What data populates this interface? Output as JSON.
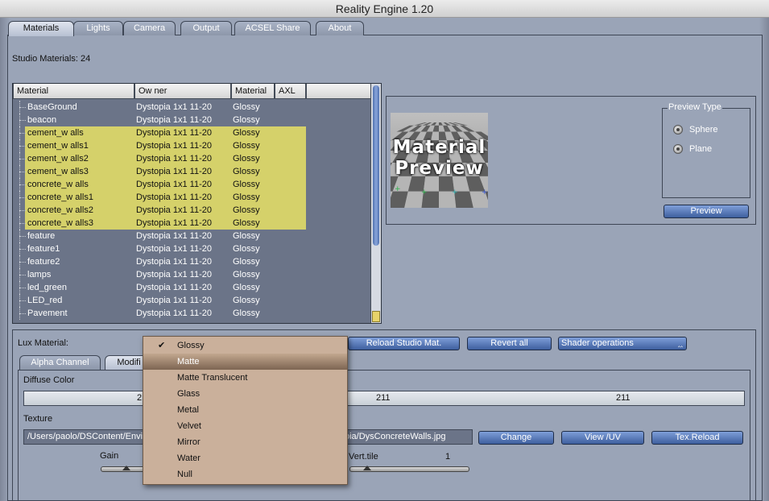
{
  "window": {
    "title": "Reality Engine 1.20"
  },
  "tabs": [
    {
      "label": "Materials",
      "active": true
    },
    {
      "label": "Lights"
    },
    {
      "label": "Camera"
    },
    {
      "label": "Output"
    },
    {
      "label": "ACSEL Share"
    },
    {
      "label": "About"
    }
  ],
  "studio_materials_label": "Studio Materials: 24",
  "table": {
    "columns": [
      "Material",
      "Ow ner",
      "Material",
      "AXL"
    ],
    "rows": [
      {
        "name": "BaseGround",
        "owner": "Dystopia 1x1 11-20",
        "type": "Glossy",
        "selected": false
      },
      {
        "name": "beacon",
        "owner": "Dystopia 1x1 11-20",
        "type": "Glossy",
        "selected": false
      },
      {
        "name": "cement_w alls",
        "owner": "Dystopia 1x1 11-20",
        "type": "Glossy",
        "selected": true
      },
      {
        "name": "cement_w alls1",
        "owner": "Dystopia 1x1 11-20",
        "type": "Glossy",
        "selected": true
      },
      {
        "name": "cement_w alls2",
        "owner": "Dystopia 1x1 11-20",
        "type": "Glossy",
        "selected": true
      },
      {
        "name": "cement_w alls3",
        "owner": "Dystopia 1x1 11-20",
        "type": "Glossy",
        "selected": true
      },
      {
        "name": "concrete_w alls",
        "owner": "Dystopia 1x1 11-20",
        "type": "Glossy",
        "selected": true
      },
      {
        "name": "concrete_w alls1",
        "owner": "Dystopia 1x1 11-20",
        "type": "Glossy",
        "selected": true
      },
      {
        "name": "concrete_w alls2",
        "owner": "Dystopia 1x1 11-20",
        "type": "Glossy",
        "selected": true
      },
      {
        "name": "concrete_w alls3",
        "owner": "Dystopia 1x1 11-20",
        "type": "Glossy",
        "selected": true
      },
      {
        "name": "feature",
        "owner": "Dystopia 1x1 11-20",
        "type": "Glossy",
        "selected": false
      },
      {
        "name": "feature1",
        "owner": "Dystopia 1x1 11-20",
        "type": "Glossy",
        "selected": false
      },
      {
        "name": "feature2",
        "owner": "Dystopia 1x1 11-20",
        "type": "Glossy",
        "selected": false
      },
      {
        "name": "lamps",
        "owner": "Dystopia 1x1 11-20",
        "type": "Glossy",
        "selected": false
      },
      {
        "name": "led_green",
        "owner": "Dystopia 1x1 11-20",
        "type": "Glossy",
        "selected": false
      },
      {
        "name": "LED_red",
        "owner": "Dystopia 1x1 11-20",
        "type": "Glossy",
        "selected": false
      },
      {
        "name": "Pavement",
        "owner": "Dystopia 1x1 11-20",
        "type": "Glossy",
        "selected": false
      }
    ]
  },
  "preview": {
    "image_text_1": "Material",
    "image_text_2": "Preview",
    "preview_type_title": "Preview Type",
    "sphere_label": "Sphere",
    "plane_label": "Plane",
    "button_label": "Preview"
  },
  "lux_material_label": "Lux Material:",
  "buttons": {
    "reload": "Reload Studio Mat.",
    "revert": "Revert all",
    "shader_ops": "Shader operations"
  },
  "subtabs": [
    {
      "label": "Alpha Channel"
    },
    {
      "label": "Modifi",
      "active": true
    }
  ],
  "diffuse": {
    "label": "Diffuse Color",
    "r": "211",
    "g": "211",
    "b": "211",
    "r_visible": "21"
  },
  "texture": {
    "label": "Texture",
    "path_start": "/Users/paolo/DSContent/Envir",
    "path_end": "oia/DysConcreteWalls.jpg",
    "change": "Change",
    "view_uv": "View /UV",
    "reload": "Tex.Reload"
  },
  "gain_label": "Gain",
  "vtile_label": "Vert.tile",
  "vtile_value": "1",
  "dropdown": {
    "items": [
      {
        "label": "Glossy",
        "checked": true
      },
      {
        "label": "Matte",
        "hover": true
      },
      {
        "label": "Matte Translucent"
      },
      {
        "label": "Glass"
      },
      {
        "label": "Metal"
      },
      {
        "label": "Velvet"
      },
      {
        "label": "Mirror"
      },
      {
        "label": "Water"
      },
      {
        "label": "Null"
      }
    ]
  },
  "colors": {
    "selection": "#d5d16a",
    "button": "#4e6fae",
    "menu_bg": "#cab09b"
  }
}
